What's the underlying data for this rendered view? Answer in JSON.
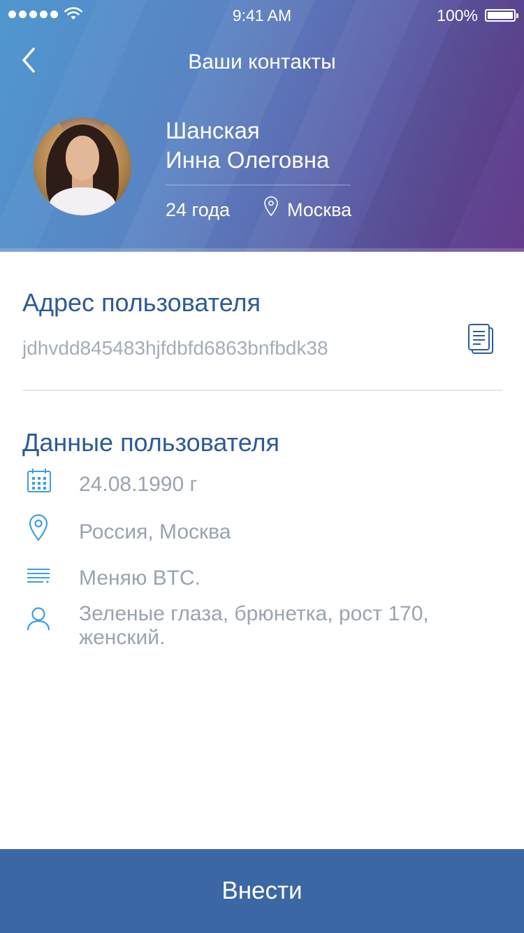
{
  "status_bar": {
    "time": "9:41 AM",
    "battery": "100%",
    "battery_level": 1.0,
    "signal_bars": 5
  },
  "header": {
    "title": "Ваши контакты",
    "back_icon": "chevron-left-icon",
    "profile": {
      "name_line1": "Шанская",
      "name_line2": "Инна Олеговна",
      "age": "24 года",
      "city": "Москва",
      "location_icon": "map-pin-icon"
    }
  },
  "address_section": {
    "title": "Адрес пользователя",
    "address": "jdhvdd845483hjfdbfd6863bnfbdk38",
    "copy_icon": "copy-icon"
  },
  "data_section": {
    "title": "Данные пользователя",
    "rows": [
      {
        "icon": "calendar-icon",
        "text": "24.08.1990 г"
      },
      {
        "icon": "map-pin-icon",
        "text": "Россия, Москва"
      },
      {
        "icon": "text-lines-icon",
        "text": "Меняю BTC."
      },
      {
        "icon": "user-icon",
        "text": "Зеленые глаза, брюнетка, рост 170, женский."
      }
    ]
  },
  "action": {
    "label": "Внести"
  },
  "colors": {
    "accent": "#3b67a4",
    "section_title": "#2e5a98",
    "icon": "#3aa0e0",
    "muted_text": "#9aa4b0",
    "header_gradient_start": "#4f97d0",
    "header_gradient_end": "#643c8c"
  }
}
